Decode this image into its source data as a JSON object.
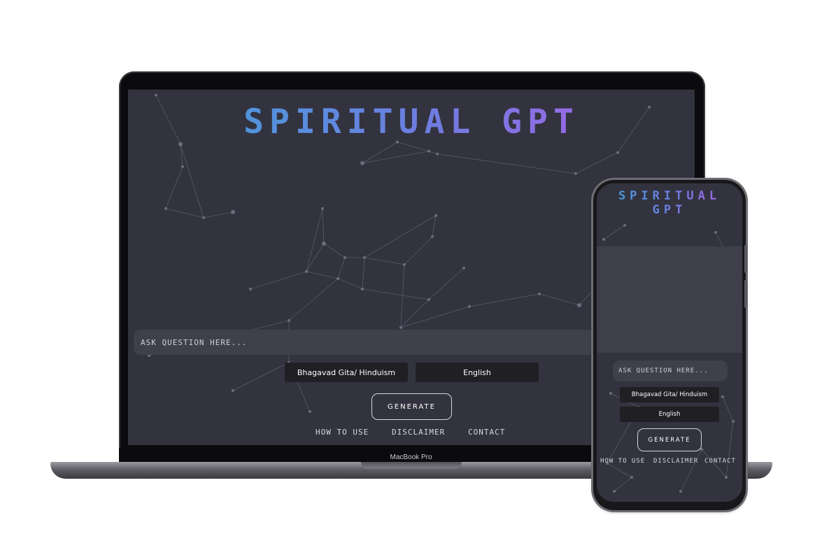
{
  "laptop": {
    "device_label": "MacBook Pro",
    "app": {
      "title": "SPIRITUAL GPT",
      "question_placeholder": "ASK QUESTION HERE...",
      "religion_select": "Bhagavad Gita/ Hinduism",
      "language_select": "English",
      "generate_button": "GENERATE",
      "footer": {
        "how_to_use": "HOW TO USE",
        "disclaimer": "DISCLAIMER",
        "contact": "CONTACT"
      }
    }
  },
  "phone": {
    "app": {
      "title_line1": "SPIRITUAL",
      "title_line2": "GPT",
      "question_placeholder": "ASK QUESTION HERE...",
      "religion_select": "Bhagavad Gita/ Hinduism",
      "language_select": "English",
      "generate_button": "GENERATE",
      "footer": {
        "how_to_use": "HOW TO USE",
        "disclaimer": "DISCLAIMER",
        "contact": "CONTACT"
      }
    }
  },
  "colors": {
    "background": "#33333f",
    "title_gradient_start": "#3ea2d8",
    "title_gradient_end": "#b15ae6",
    "input_background": "#3f404c",
    "select_background": "#1f1f24"
  }
}
